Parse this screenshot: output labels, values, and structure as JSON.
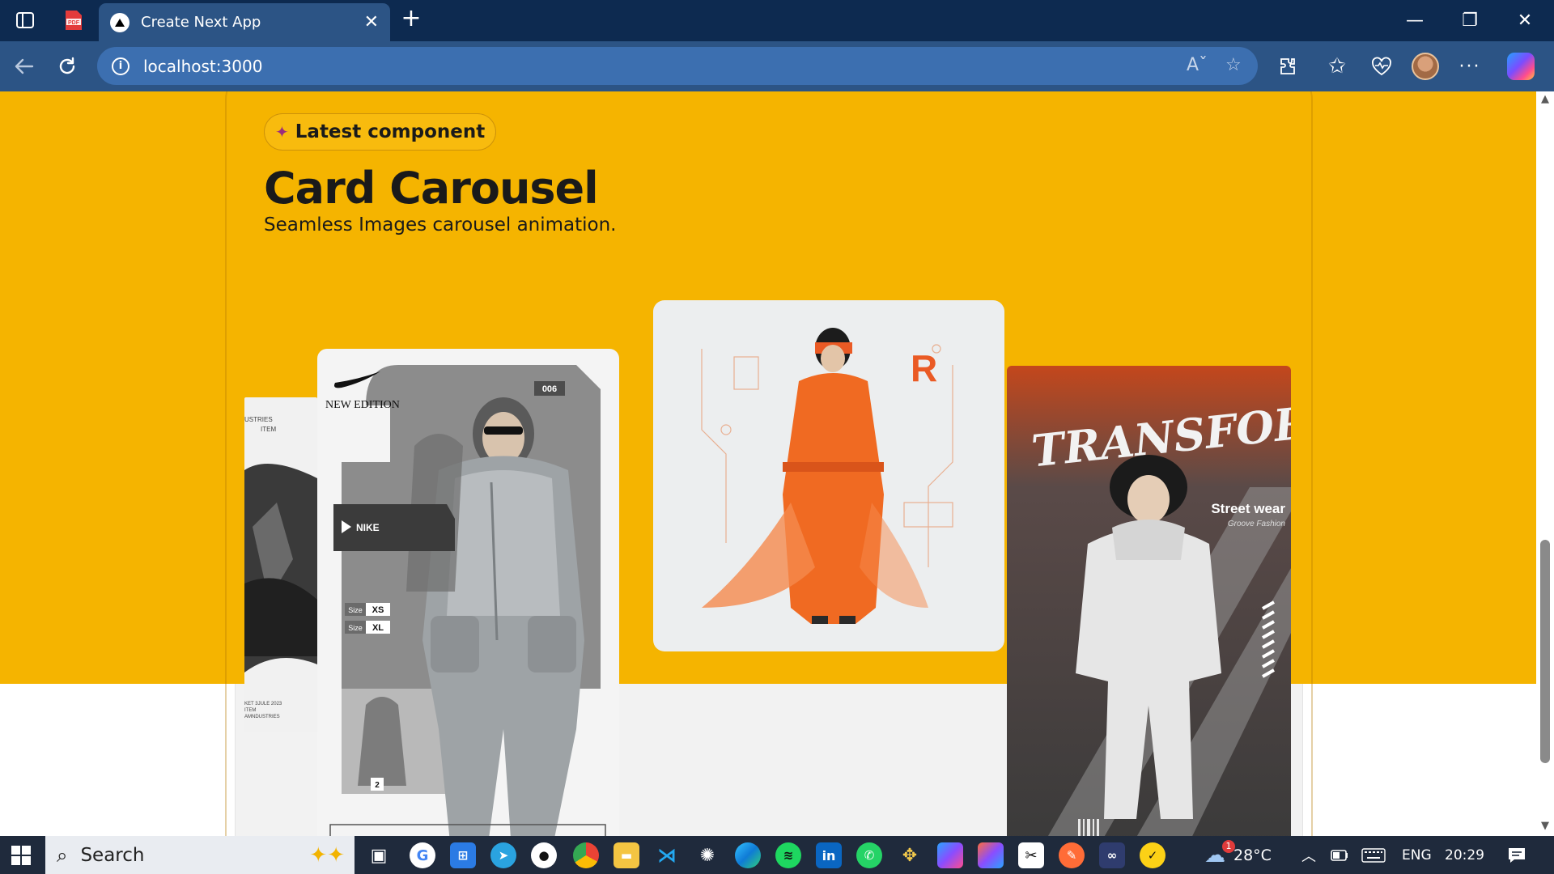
{
  "browser": {
    "tab_title": "Create Next App",
    "tab_close": "✕",
    "new_tab": "+",
    "url": "localhost:3000",
    "window_controls": {
      "minimize": "—",
      "restore": "❐",
      "close": "✕"
    },
    "icons": [
      "sidebar-icon",
      "pdf-icon",
      "back-icon",
      "refresh-icon",
      "info-icon",
      "read-aloud-icon",
      "favorite-star-icon",
      "extensions-icon",
      "favorites-icon",
      "browser-essentials-icon",
      "profile-avatar",
      "more-icon",
      "copilot-icon"
    ]
  },
  "page": {
    "badge_text": "Latest component",
    "title": "Card Carousel",
    "subtitle": "Seamless Images carousel animation.",
    "cards": {
      "left_partial": {
        "text_top": "USTRIES",
        "text_item": "ITEM",
        "footer_lines": [
          "KET 3JULE 2023",
          "ITEM",
          "AMNDUSTRIES"
        ]
      },
      "nike": {
        "edition": "NEW EDITION",
        "number": "006",
        "brand": "NIKE",
        "size_label": "Size",
        "sizes": [
          "XS",
          "XL"
        ],
        "page": "2"
      },
      "orange": {
        "logo": "R"
      },
      "streetwear": {
        "graffiti": "TRANSFORM",
        "headline": "Street wear",
        "tagline": "Groove Fashion"
      }
    }
  },
  "taskbar": {
    "search_placeholder": "Search",
    "weather_temp": "28°C",
    "weather_badge": "1",
    "language": "ENG",
    "time": "20:29",
    "apps": [
      "start-icon",
      "task-view-icon",
      "google-icon",
      "store-icon",
      "telegram-icon",
      "chat-icon",
      "chrome-icon",
      "file-explorer-icon",
      "vscode-icon",
      "chatgpt-icon",
      "edge-icon",
      "spotify-icon",
      "linkedin-icon",
      "whatsapp-icon",
      "app-icon",
      "copilot-app-icon",
      "m365-icon",
      "capcut-icon",
      "postman-icon",
      "visual-studio-icon",
      "norton-icon"
    ]
  },
  "colors": {
    "page_yellow": "#f5b400",
    "titlebar": "#0d2a50",
    "toolbar": "#2c5485",
    "taskbar": "#1f2a3c"
  }
}
